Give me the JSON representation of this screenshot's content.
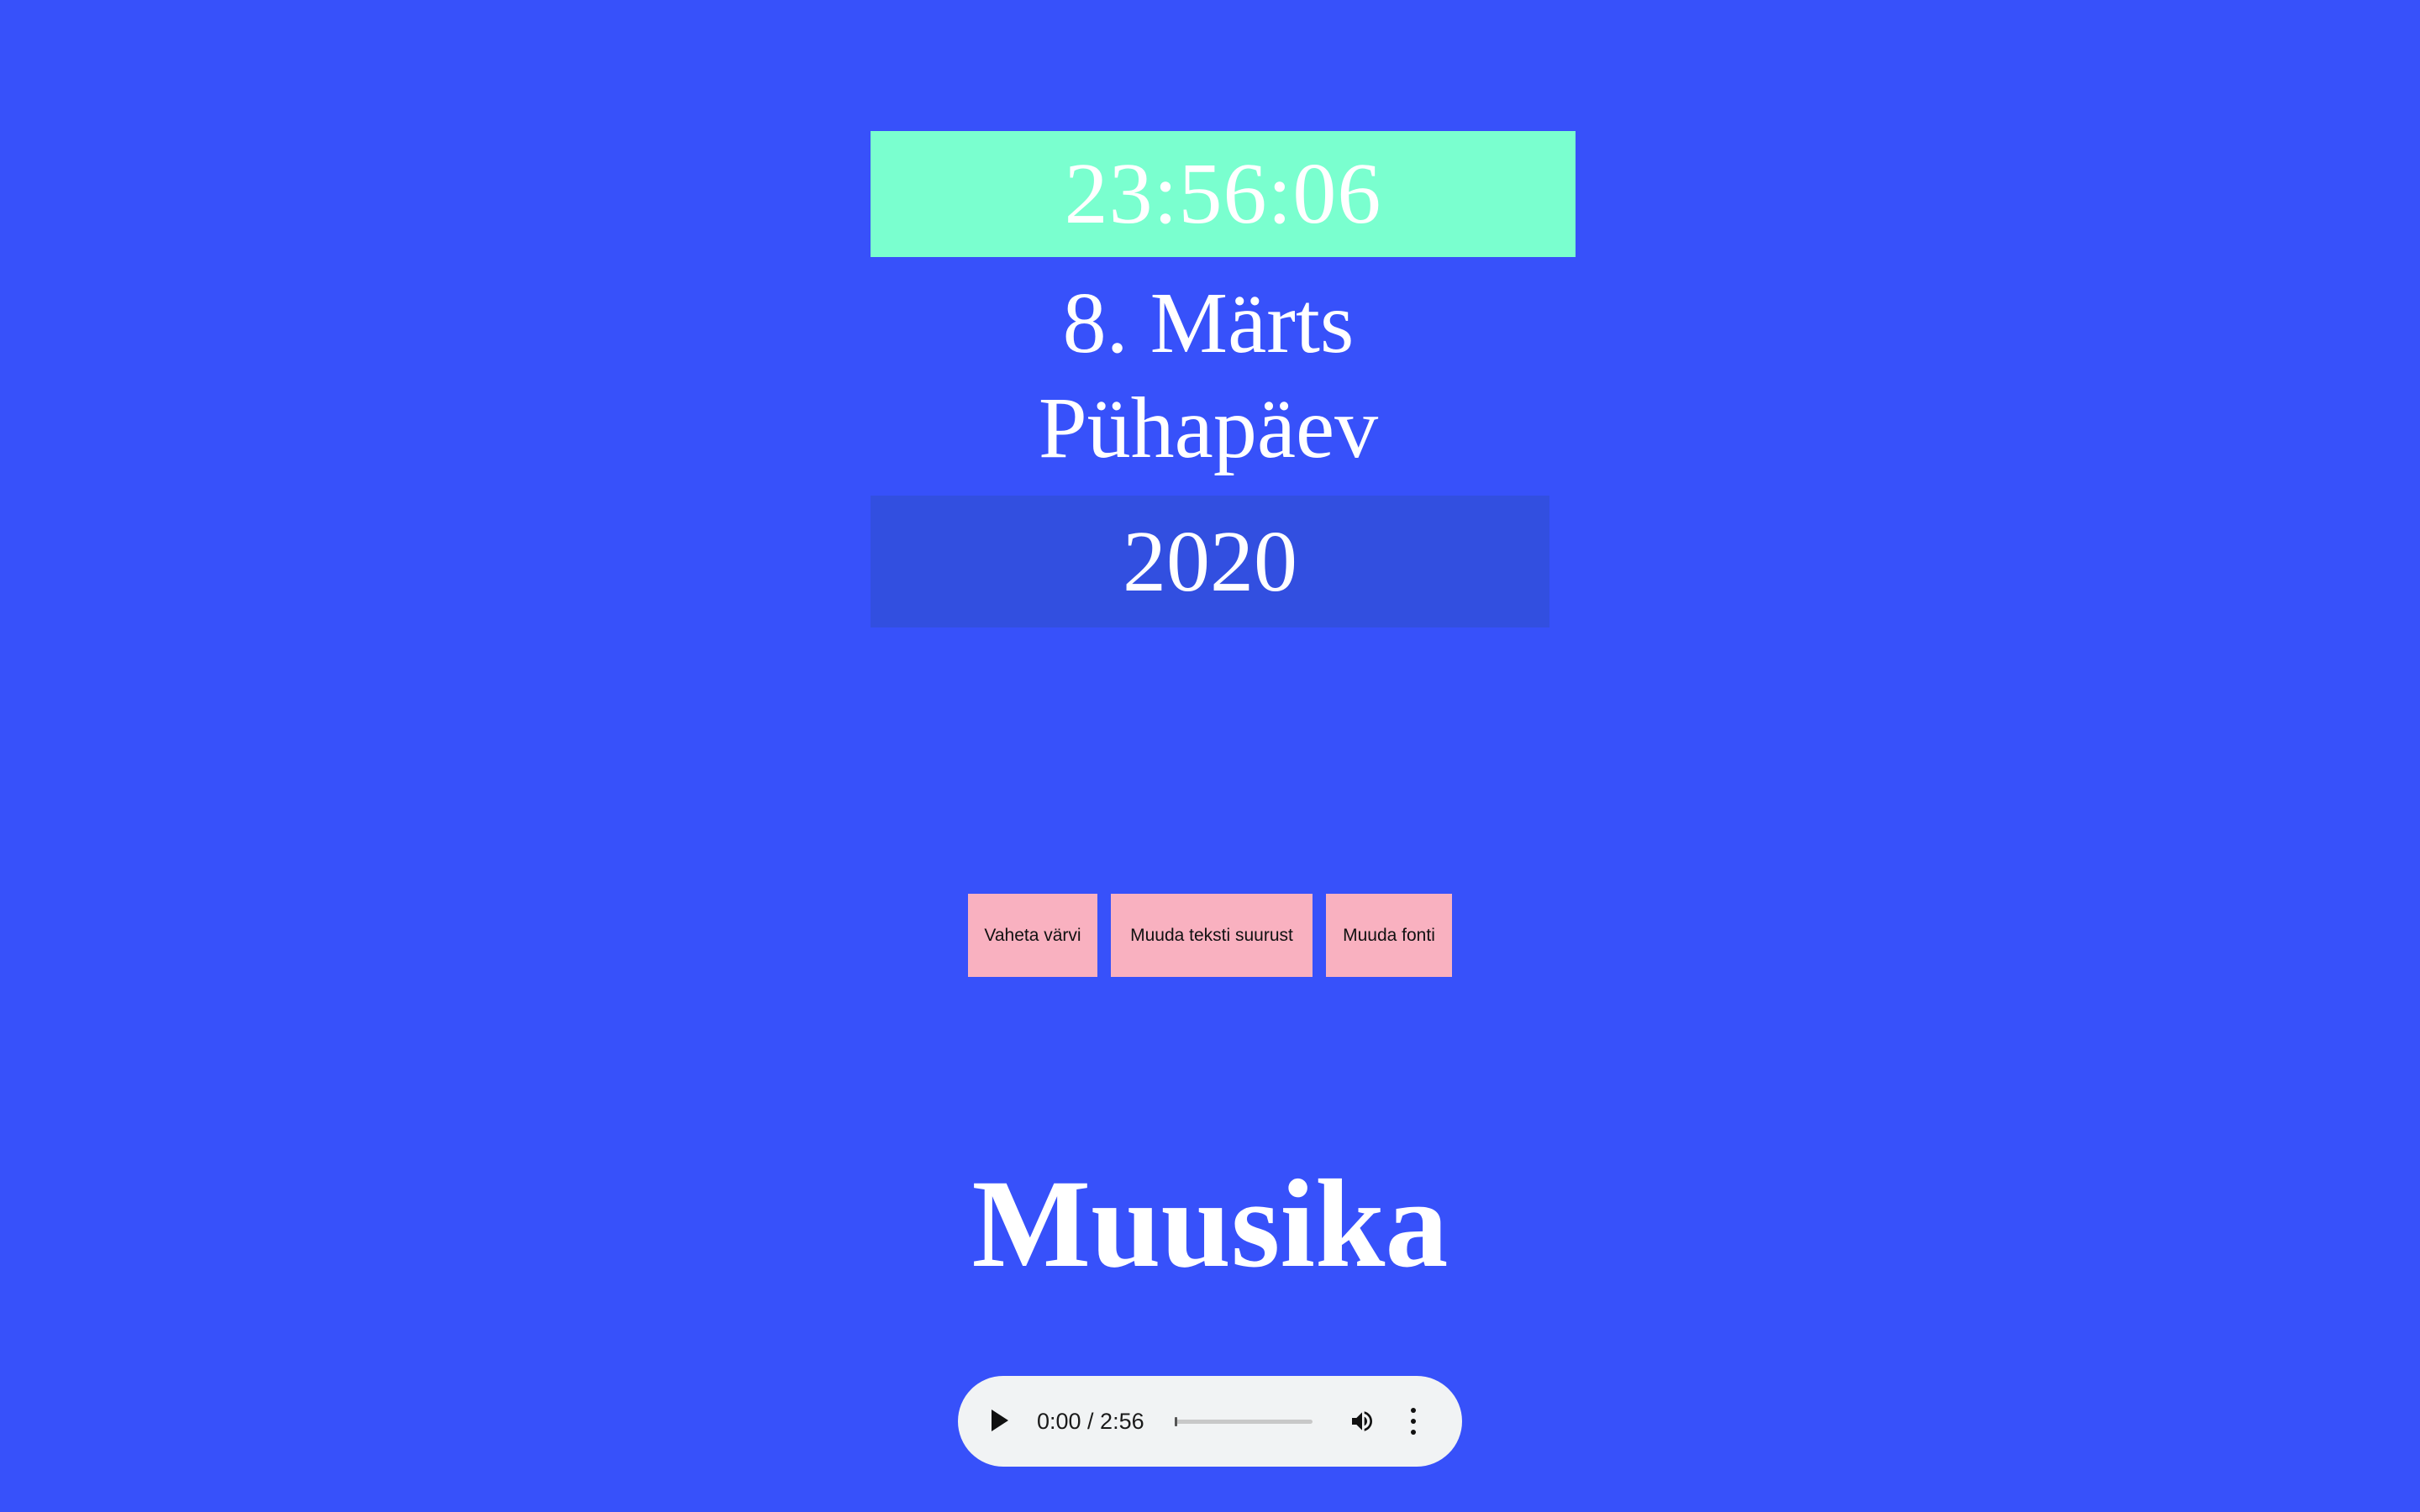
{
  "clock": {
    "time": "23:56:06",
    "bg_color": "#7affcf"
  },
  "date": {
    "day_month": "8. Märts",
    "weekday": "Pühapäev",
    "year": "2020",
    "year_bg_color": "#324fe0"
  },
  "page": {
    "bg_color": "#3751fa"
  },
  "controls": {
    "change_color_label": "Vaheta värvi",
    "change_size_label": "Muuda teksti suurust",
    "change_font_label": "Muuda fonti",
    "button_color": "#f9b1c0"
  },
  "music": {
    "title": "Muusika",
    "player": {
      "time": "0:00 / 2:56",
      "progress": 0,
      "play_icon": "play-icon",
      "volume_icon": "volume-icon",
      "menu_icon": "more-vert-icon"
    }
  }
}
